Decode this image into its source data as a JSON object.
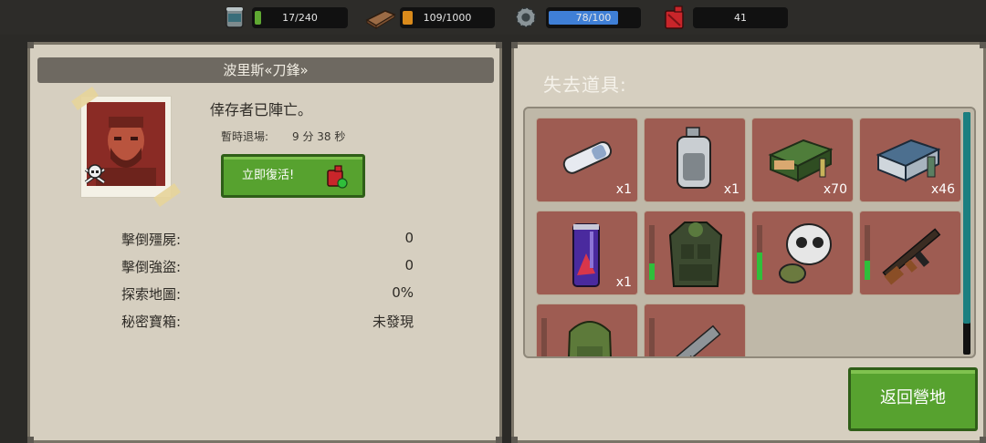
{
  "resources": {
    "food": {
      "icon": "canned-food-icon",
      "value": "17/240",
      "fill": 0.07,
      "color": "#5fa832"
    },
    "wood": {
      "icon": "wood-log-icon",
      "value": "109/1000",
      "fill": 0.11,
      "color": "#d98a1b"
    },
    "energy": {
      "icon": "gear-icon",
      "value": "78/100",
      "fill": 0.78,
      "color": "#3f7fd6"
    },
    "fuel": {
      "icon": "fuel-can-icon",
      "value": "41"
    }
  },
  "survivor": {
    "name": "波里斯«刀鋒»",
    "status": "倖存者已陣亡。",
    "timer_label": "暫時退場:",
    "timer_value": "9 分 38 秒",
    "revive_label": "立即復活!"
  },
  "stats": [
    {
      "label": "擊倒殭屍:",
      "value": "0"
    },
    {
      "label": "擊倒強盜:",
      "value": "0"
    },
    {
      "label": "探索地圖:",
      "value": "0%"
    },
    {
      "label": "秘密寶箱:",
      "value": "未發現"
    }
  ],
  "lost_items": {
    "title": "失去道具:",
    "items": [
      {
        "icon": "bandage-icon",
        "count": "x1"
      },
      {
        "icon": "blood-bag-icon",
        "count": "x1"
      },
      {
        "icon": "rifle-ammo-box-icon",
        "count": "x70"
      },
      {
        "icon": "shotgun-ammo-box-icon",
        "count": "x46"
      },
      {
        "icon": "energy-drink-icon",
        "count": "x1"
      },
      {
        "icon": "military-vest-icon",
        "durability": 0.3
      },
      {
        "icon": "gas-mask-icon",
        "durability": 0.5
      },
      {
        "icon": "assault-rifle-icon",
        "durability": 0.35
      },
      {
        "icon": "backpack-icon",
        "durability": 0.15
      },
      {
        "icon": "pistol-icon"
      }
    ]
  },
  "return_label": "返回營地"
}
